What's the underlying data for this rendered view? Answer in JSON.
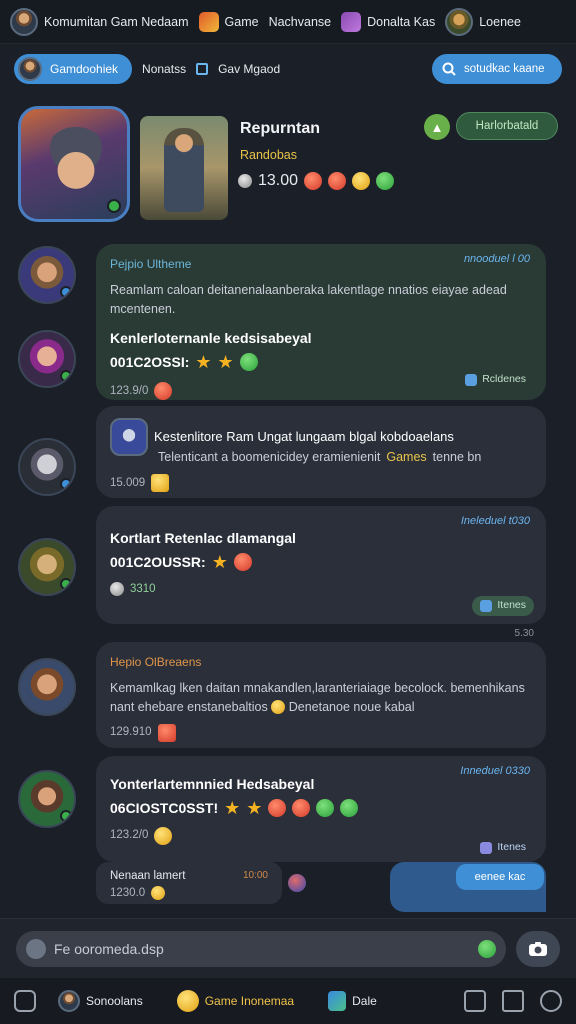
{
  "topbar": {
    "title": "Komumitan Gam Nedaam",
    "items": [
      {
        "label": "Game",
        "icon": "game-shield-icon"
      },
      {
        "label": "Nachvanse"
      },
      {
        "label": "Donalta Kas",
        "icon": "potion-icon"
      },
      {
        "label": "Loenee"
      }
    ]
  },
  "subbar": {
    "active_tab": "Gamdoohiek",
    "label": "Nonatss",
    "label2": "Gav Mgaod",
    "search_placeholder": "sotudkac kaane"
  },
  "hero": {
    "title": "Repurntan",
    "subtitle": "Randobas",
    "count": "13.00",
    "badge": "Harlorbatald"
  },
  "messages": [
    {
      "header": "Pejpio Ultheme",
      "time": "nnooduel l 00",
      "text": "Reamlam caloan deitanenalaanberaka lakentlage nnatios eiayae adead mcentenen.",
      "strong": "Kenlerloternanle kedsisabeyal",
      "score": "001C2OSSI:",
      "foot_count": "123.9/0",
      "tag": "Rcldenes"
    },
    {
      "header": "Kestenlitore Ram Ungat lungaam blgal kobdoaelans",
      "text_pre": "Telenticant a boomenicidey eramienienit",
      "text_hl": "Games",
      "text_post": "tenne bn",
      "foot_count": "15.009"
    },
    {
      "time": "Ineleduel t030",
      "strong": "Kortlart Retenlac dlamangal",
      "score": "001C2OUSSR:",
      "foot_count": "3310",
      "tag": "Itenes"
    },
    {
      "header": "Hepio OlBreaens",
      "text": "Kemamlkag lken daitan mnakandlen,laranteriaiage becolock. bemenhikans nant ehebare enstanebaltios",
      "text_post": "Denetanoe noue kabal",
      "foot_count": "129.910",
      "side_time": "5.30"
    },
    {
      "time": "Inneduel 0330",
      "strong": "Yonterlartemnnied Hedsabeyal",
      "score": "06CIOSTC0SST!",
      "foot_count": "123.2/0",
      "tag": "Itenes"
    },
    {
      "header": "Nenaan lamert",
      "time_small": "10:00",
      "foot_count": "1230.0",
      "reply": "eenee kac"
    }
  ],
  "composer": {
    "placeholder": "Fe ooromeda.dsp"
  },
  "bottomnav": {
    "items": [
      {
        "label": ""
      },
      {
        "label": "Sonoolans"
      },
      {
        "label": "Game Inonemaa"
      },
      {
        "label": "Dale"
      }
    ]
  },
  "colors": {
    "accent_blue": "#3f8fd6",
    "bubble_green": "#2a3a35",
    "bubble_gray": "#2a2f3a",
    "gold": "#e8c44a"
  }
}
